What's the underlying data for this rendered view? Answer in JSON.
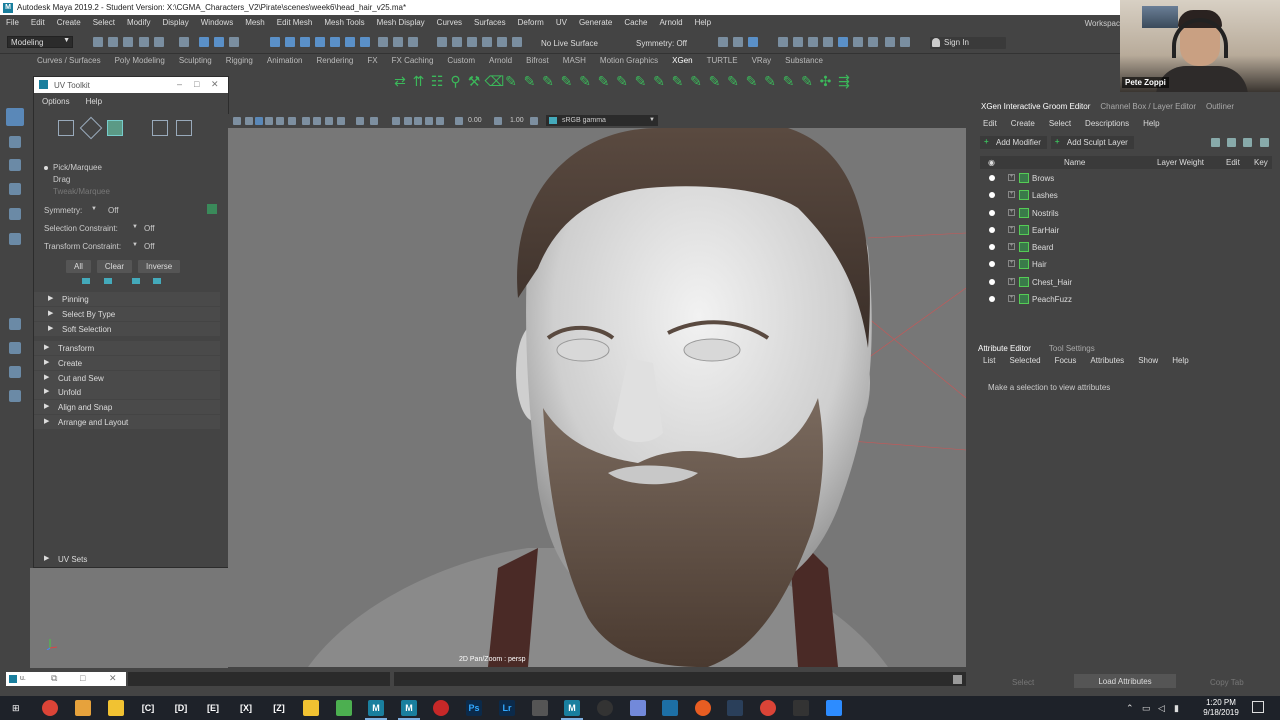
{
  "window": {
    "title": "Autodesk Maya 2019.2 - Student Version: X:\\CGMA_Characters_V2\\Pirate\\scenes\\week6\\head_hair_v25.ma*",
    "workspace": "Workspac"
  },
  "menubar": [
    "File",
    "Edit",
    "Create",
    "Select",
    "Modify",
    "Display",
    "Windows",
    "Mesh",
    "Edit Mesh",
    "Mesh Tools",
    "Mesh Display",
    "Curves",
    "Surfaces",
    "Deform",
    "UV",
    "Generate",
    "Cache",
    "Arnold",
    "Help"
  ],
  "statusline": {
    "mode": "Modeling",
    "live_surface": "No Live Surface",
    "symmetry": "Symmetry: Off",
    "sign_in": "Sign In"
  },
  "shelf_tabs": [
    "Curves / Surfaces",
    "Poly Modeling",
    "Sculpting",
    "Rigging",
    "Animation",
    "Rendering",
    "FX",
    "FX Caching",
    "Custom",
    "Arnold",
    "Bifrost",
    "MASH",
    "Motion Graphics",
    "XGen",
    "TURTLE",
    "VRay",
    "Substance"
  ],
  "shelf_active": "XGen",
  "webcam": {
    "name": "Pete Zoppi"
  },
  "uv_toolkit": {
    "title": "UV Toolkit",
    "menu": [
      "Options",
      "Help"
    ],
    "tools": [
      "Pick/Marquee",
      "Drag",
      "Tweak/Marquee"
    ],
    "symmetry_label": "Symmetry:",
    "symmetry_value": "Off",
    "selection_constraint_label": "Selection Constraint:",
    "selection_constraint_value": "Off",
    "transform_constraint_label": "Transform Constraint:",
    "transform_constraint_value": "Off",
    "buttons": [
      "All",
      "Clear",
      "Inverse"
    ],
    "subsections": [
      "Pinning",
      "Select By Type",
      "Soft Selection"
    ],
    "sections": [
      "Transform",
      "Create",
      "Cut and Sew",
      "Unfold",
      "Align and Snap",
      "Arrange and Layout"
    ],
    "uv_sets": "UV Sets"
  },
  "viewport": {
    "exposure": "0.00",
    "gamma": "1.00",
    "color_space": "sRGB gamma",
    "label": "2D Pan/Zoom : persp"
  },
  "right_panel": {
    "tabs": [
      "XGen Interactive Groom Editor",
      "Channel Box / Layer Editor",
      "Outliner"
    ],
    "menu": [
      "Edit",
      "Create",
      "Select",
      "Descriptions",
      "Help"
    ],
    "add_modifier": "Add Modifier",
    "add_sculpt_layer": "Add Sculpt Layer",
    "columns": [
      "Name",
      "Layer Weight",
      "Edit",
      "Key"
    ],
    "descriptions": [
      "Brows",
      "Lashes",
      "Nostrils",
      "EarHair",
      "Beard",
      "Hair",
      "Chest_Hair",
      "PeachFuzz"
    ],
    "attr_tabs": [
      "Attribute Editor",
      "Tool Settings"
    ],
    "attr_menu": [
      "List",
      "Selected",
      "Focus",
      "Attributes",
      "Show",
      "Help"
    ],
    "attr_message": "Make a selection to view attributes"
  },
  "bottom": {
    "select": "Select",
    "load_attributes": "Load Attributes",
    "copy_tab": "Copy Tab"
  },
  "taskbar": {
    "apps": [
      "[C]",
      "[D]",
      "[E]",
      "[X]",
      "[Z]"
    ],
    "time": "1:20 PM",
    "date": "9/18/2019"
  },
  "colors": {
    "maya_bg": "#444444",
    "viewport_bg": "#777777",
    "xgen_green": "#3bb85a",
    "select_blue": "#5a88b8"
  }
}
